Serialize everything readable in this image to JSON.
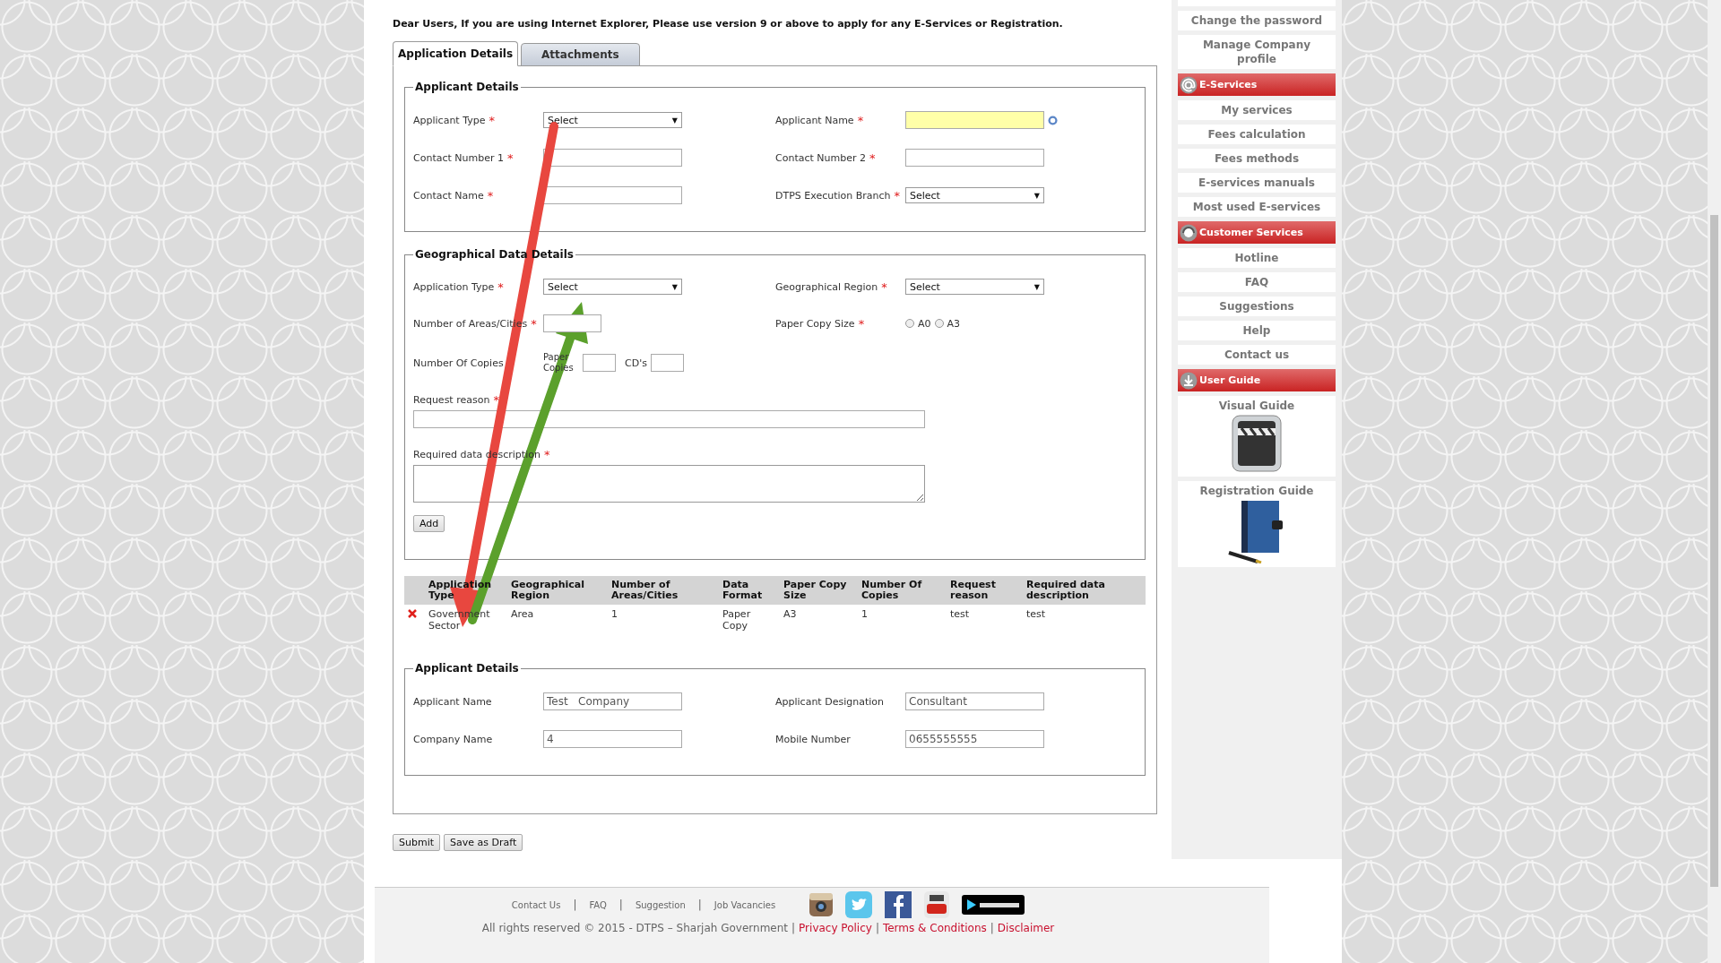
{
  "notice": "Dear Users, If you are using Internet Explorer, Please use version 9 or above to apply for any E-Services or Registration.",
  "tabs": [
    {
      "label": "Application Details",
      "selected": true
    },
    {
      "label": "Attachments",
      "selected": false
    }
  ],
  "applicant_details": {
    "legend": "Applicant Details",
    "fields": [
      {
        "label": "Applicant Type",
        "mark": "*",
        "kind": "select",
        "value": "Select",
        "arrow": "▼"
      },
      {
        "label": "Applicant Name",
        "mark": "*",
        "kind": "highlight"
      },
      {
        "label": "Contact Number 1",
        "mark": "*",
        "kind": "text"
      },
      {
        "label": "Contact Number 2",
        "mark": "*",
        "kind": "text"
      },
      {
        "label": "Contact Name",
        "mark": "*",
        "kind": "text"
      },
      {
        "label": "DTPS Execution Branch",
        "mark": "*",
        "kind": "select",
        "value": "Select",
        "arrow": "▼"
      }
    ]
  },
  "geo_details": {
    "legend": "Geographical Data Details",
    "fields": [
      {
        "label": "Application Type",
        "mark": "*",
        "kind": "select",
        "value": "Select",
        "arrow": "▼"
      },
      {
        "label": "Geographical Region",
        "mark": "*",
        "kind": "select",
        "value": "Select",
        "arrow": "▼"
      },
      {
        "label": "Number of Areas/Cities",
        "mark": "*",
        "kind": "short"
      },
      {
        "label": "Paper Copy Size",
        "mark": "*",
        "kind": "radio",
        "options": [
          {
            "label": "A0",
            "selected": false
          },
          {
            "label": "A3",
            "selected": false
          }
        ]
      },
      {
        "label": "Number Of Copies",
        "kind": "copies",
        "parts": [
          "Paper Copies",
          "CD's"
        ]
      },
      {
        "label": "Request reason",
        "mark": "*",
        "kind": "wide"
      },
      {
        "label": "Required data description",
        "mark": "*",
        "kind": "textarea"
      }
    ],
    "add_button": "Add"
  },
  "table": {
    "columns": [
      "Application Type",
      "Geographical Region",
      "Number of Areas/Cities",
      "Data Format",
      "Paper Copy Size",
      "Number Of Copies",
      "Request reason",
      "Required data description"
    ],
    "rows": [
      {
        "cells": [
          "Government Sector",
          "Area",
          "1",
          "Paper Copy",
          "A3",
          "1",
          "test",
          "test"
        ]
      }
    ]
  },
  "applicant_info": {
    "legend": "Applicant Details",
    "fields": [
      {
        "label": "Applicant Name",
        "value": "Test   Company"
      },
      {
        "label": "Applicant Designation",
        "value": "Consultant"
      },
      {
        "label": "Company Name",
        "value": "4"
      },
      {
        "label": "Mobile Number",
        "value": "0655555555"
      }
    ]
  },
  "buttons": [
    "Submit",
    "Save as Draft"
  ],
  "sidebar": [
    {
      "kind": "link",
      "label": "Change the password"
    },
    {
      "kind": "link",
      "label": "Manage Company profile"
    },
    {
      "kind": "header",
      "label": "E-Services"
    },
    {
      "kind": "link",
      "label": "My services"
    },
    {
      "kind": "link",
      "label": "Fees calculation"
    },
    {
      "kind": "link",
      "label": "Fees methods"
    },
    {
      "kind": "link",
      "label": "E-services manuals"
    },
    {
      "kind": "link",
      "label": "Most used E-services"
    },
    {
      "kind": "header",
      "label": "Customer Services"
    },
    {
      "kind": "link",
      "label": "Hotline"
    },
    {
      "kind": "link",
      "label": "FAQ"
    },
    {
      "kind": "link",
      "label": "Suggestions"
    },
    {
      "kind": "link",
      "label": "Help"
    },
    {
      "kind": "link",
      "label": "Contact us"
    },
    {
      "kind": "header",
      "label": "User Guide"
    },
    {
      "kind": "guide",
      "label": "Visual Guide"
    },
    {
      "kind": "guide",
      "label": "Registration Guide"
    }
  ],
  "footer": {
    "nav": [
      {
        "kind": "link",
        "text": "Contact Us"
      },
      {
        "kind": "sep",
        "text": "|"
      },
      {
        "kind": "link",
        "text": "FAQ"
      },
      {
        "kind": "sep",
        "text": "|"
      },
      {
        "kind": "link",
        "text": "Suggestion"
      },
      {
        "kind": "sep",
        "text": "|"
      },
      {
        "kind": "link",
        "text": "Job Vacancies"
      }
    ],
    "copyright": "All rights reserved © 2015 - DTPS – Sharjah Government",
    "legal": [
      {
        "kind": "sep",
        "text": "|"
      },
      {
        "kind": "link",
        "text": "Privacy Policy"
      },
      {
        "kind": "sep",
        "text": "|"
      },
      {
        "kind": "link",
        "text": "Terms & Conditions"
      },
      {
        "kind": "sep",
        "text": "|"
      },
      {
        "kind": "link",
        "text": "Disclaimer"
      }
    ]
  }
}
